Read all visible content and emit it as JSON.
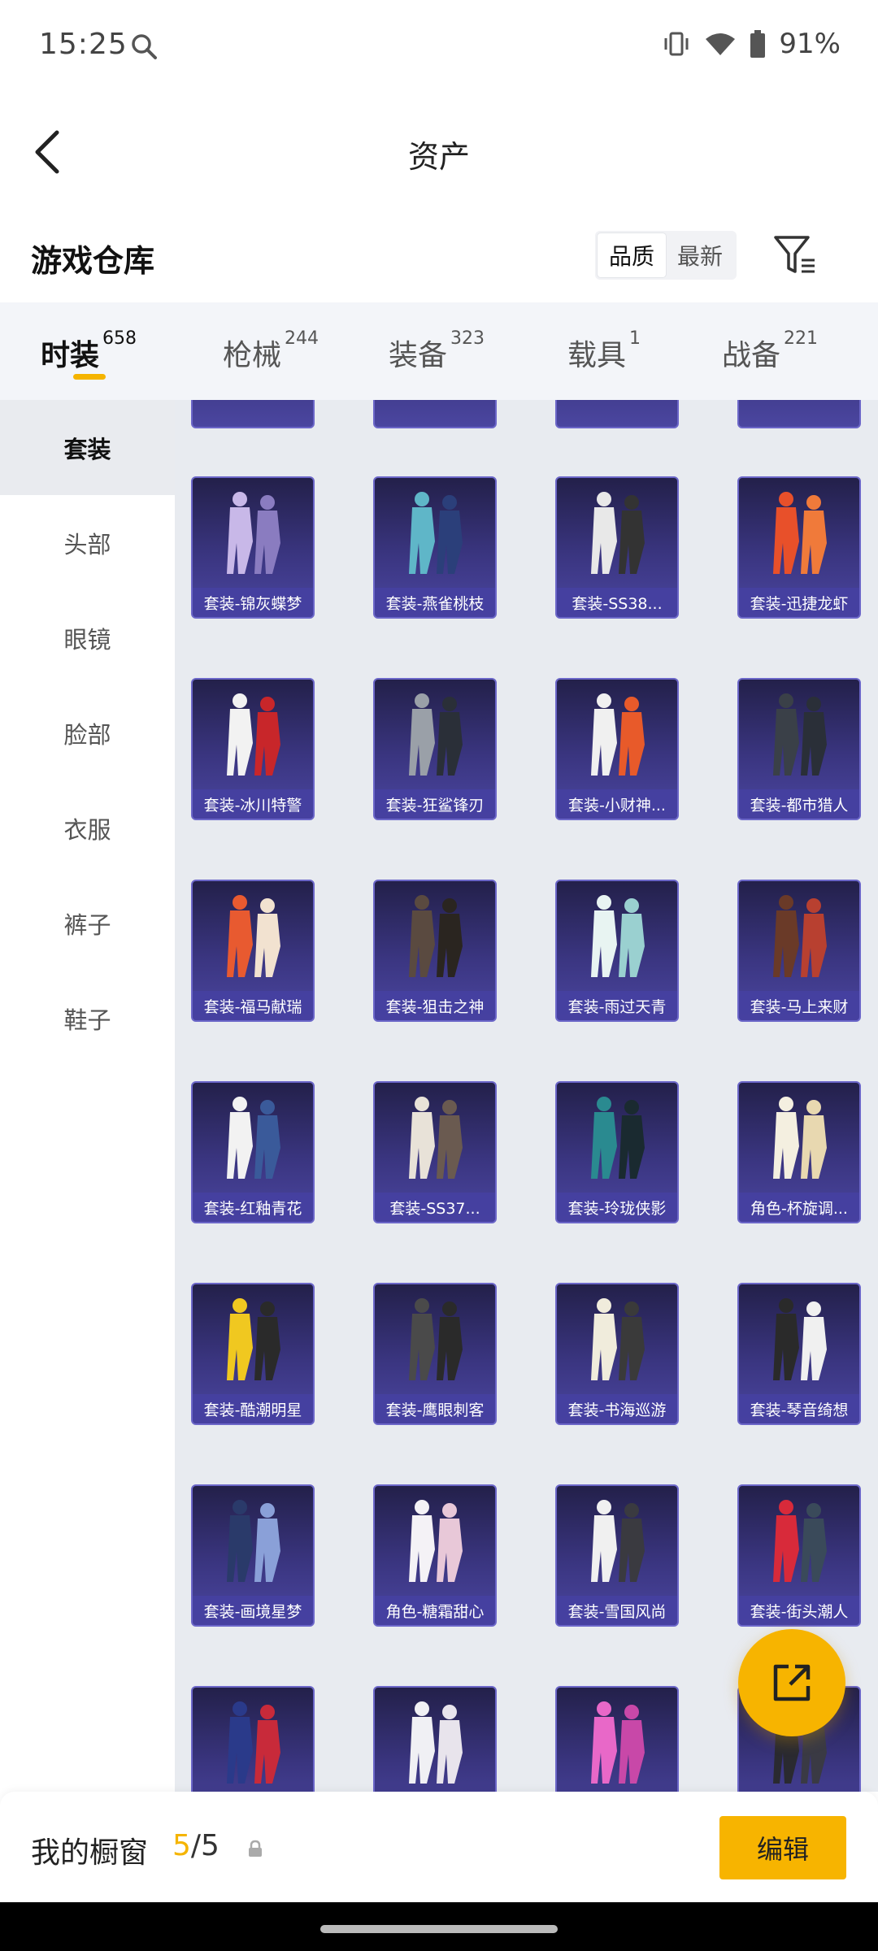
{
  "status_bar": {
    "time": "15:25",
    "battery": "91%"
  },
  "header": {
    "title": "资产"
  },
  "section": {
    "title": "游戏仓库",
    "sort_quality": "品质",
    "sort_newest": "最新"
  },
  "tabs": [
    {
      "label": "时装",
      "count": "658"
    },
    {
      "label": "枪械",
      "count": "244"
    },
    {
      "label": "装备",
      "count": "323"
    },
    {
      "label": "载具",
      "count": "1"
    },
    {
      "label": "战备",
      "count": "221"
    }
  ],
  "sidebar": [
    "套装",
    "头部",
    "眼镜",
    "脸部",
    "衣服",
    "裤子",
    "鞋子"
  ],
  "grid": {
    "items": [
      "套装-锦灰蝶梦",
      "套装-燕雀桃枝",
      "套装-SS38...",
      "套装-迅捷龙虾",
      "套装-冰川特警",
      "套装-狂鲨锋刃",
      "套装-小财神...",
      "套装-都市猎人",
      "套装-福马献瑞",
      "套装-狙击之神",
      "套装-雨过天青",
      "套装-马上来财",
      "套装-红釉青花",
      "套装-SS37...",
      "套装-玲珑侠影",
      "角色-杯旋调...",
      "套装-酷潮明星",
      "套装-鹰眼刺客",
      "套装-书海巡游",
      "套装-琴音绮想",
      "套装-画境星梦",
      "角色-糖霜甜心",
      "套装-雪国风尚",
      "套装-街头潮人"
    ]
  },
  "bottom_bar": {
    "showcase_label": "我的橱窗",
    "current": "5",
    "total": "5",
    "edit_label": "编辑"
  },
  "colors": {
    "accent": "#f7b400",
    "card_bg": "#3a3580",
    "card_label": "#4640a0"
  }
}
